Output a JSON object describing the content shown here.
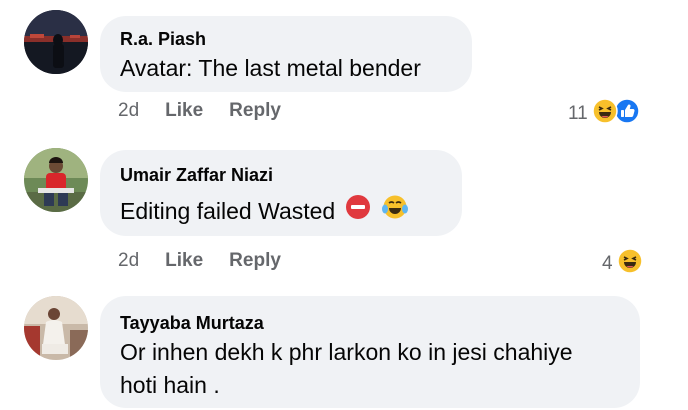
{
  "comments": [
    {
      "author": "R.a. Piash",
      "text": "Avatar: The last metal bender",
      "time": "2d",
      "like_label": "Like",
      "reply_label": "Reply",
      "reaction_count": "11",
      "reactions": [
        "haha-icon",
        "like-icon"
      ]
    },
    {
      "author": "Umair Zaffar Niazi",
      "text": "Editing failed Wasted",
      "text_emojis": [
        "no-entry-icon",
        "laughing-tears-icon"
      ],
      "time": "2d",
      "like_label": "Like",
      "reply_label": "Reply",
      "reaction_count": "4",
      "reactions": [
        "haha-icon"
      ]
    },
    {
      "author": "Tayyaba Murtaza",
      "text_line1": "Or inhen dekh k phr larkon ko in jesi chahiye",
      "text_line2": "hoti hain ."
    }
  ],
  "colors": {
    "bubble": "#f0f2f5",
    "meta": "#65676b",
    "like_blue": "#1877f2",
    "haha_yellow": "#f7c02b"
  }
}
